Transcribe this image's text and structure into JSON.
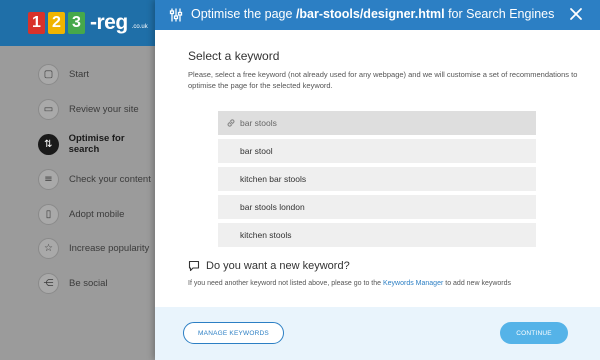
{
  "brand": {
    "digit1": "1",
    "digit2": "2",
    "digit3": "3",
    "text": "-reg",
    "suffix": ".co.uk"
  },
  "sidebar": {
    "items": [
      {
        "label": "Start",
        "icon": "square-icon",
        "glyph": "▢",
        "active": false
      },
      {
        "label": "Review your site",
        "icon": "monitor-icon",
        "glyph": "▭",
        "active": false
      },
      {
        "label": "Optimise for search",
        "icon": "sliders-icon",
        "glyph": "⇅",
        "active": true
      },
      {
        "label": "Check your content",
        "icon": "list-icon",
        "glyph": "≡",
        "active": false
      },
      {
        "label": "Adopt mobile",
        "icon": "mobile-icon",
        "glyph": "▯",
        "active": false
      },
      {
        "label": "Increase popularity",
        "icon": "star-icon",
        "glyph": "☆",
        "active": false
      },
      {
        "label": "Be social",
        "icon": "share-icon",
        "glyph": "⋲",
        "active": false
      }
    ]
  },
  "modal": {
    "title_prefix": "Optimise the page",
    "title_path": "/bar-stools/designer.html",
    "title_suffix": "for Search Engines",
    "section_title": "Select a keyword",
    "section_desc": "Please, select a free keyword (not already used for any webpage) and we will customise a set of recommendations to optimise the page for the selected keyword.",
    "keywords": [
      {
        "label": "bar stools",
        "selected": true
      },
      {
        "label": "bar stool",
        "selected": false
      },
      {
        "label": "kitchen bar stools",
        "selected": false
      },
      {
        "label": "bar stools london",
        "selected": false
      },
      {
        "label": "kitchen stools",
        "selected": false
      }
    ],
    "new_kw_title": "Do you want a new keyword?",
    "new_kw_desc_before": "If you need another keyword not listed above, please go to the",
    "new_kw_link": "Keywords Manager",
    "new_kw_desc_after": "to add new keywords"
  },
  "footer": {
    "manage_label": "MANAGE KEYWORDS",
    "continue_label": "CONTINUE"
  },
  "colors": {
    "header_blue": "#2c7fc4",
    "topbar_blue": "#1f6fa8",
    "continue_blue": "#55b3e8",
    "footer_bg": "#e9f4fc"
  }
}
